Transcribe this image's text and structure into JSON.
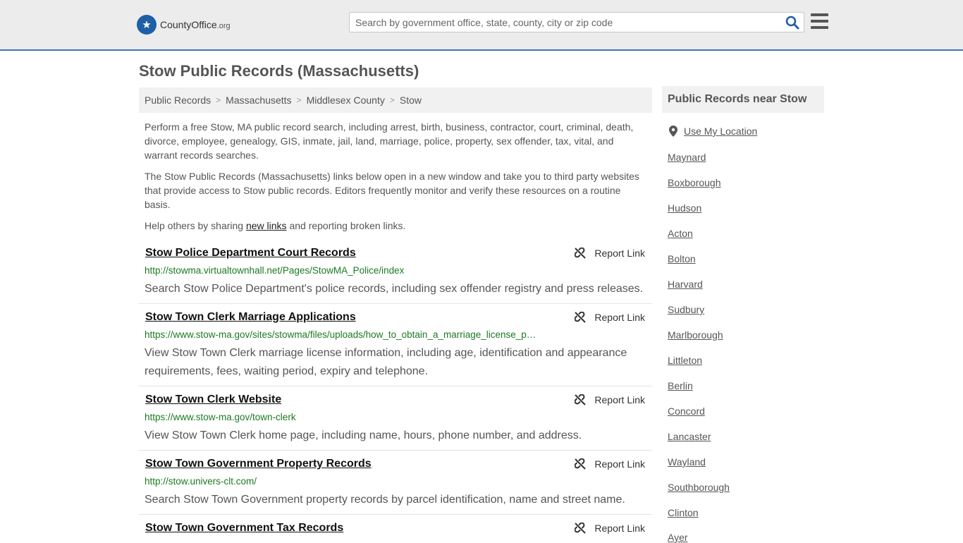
{
  "header": {
    "logo_main": "CountyOffice",
    "logo_tld": ".org",
    "search_placeholder": "Search by government office, state, county, city or zip code",
    "search_icon": "search-icon",
    "menu_icon": "hamburger-menu-icon",
    "accent": "#3f75b3"
  },
  "page": {
    "title": "Stow Public Records (Massachusetts)"
  },
  "breadcrumb": [
    "Public Records",
    "Massachusetts",
    "Middlesex County",
    "Stow"
  ],
  "intro": {
    "p1": "Perform a free Stow, MA public record search, including arrest, birth, business, contractor, court, criminal, death, divorce, employee, genealogy, GIS, inmate, jail, land, marriage, police, property, sex offender, tax, vital, and warrant records searches.",
    "p2": "The Stow Public Records (Massachusetts) links below open in a new window and take you to third party websites that provide access to Stow public records. Editors frequently monitor and verify these resources on a routine basis.",
    "p3_before": "Help others by sharing ",
    "p3_link": "new links",
    "p3_after": " and reporting broken links."
  },
  "report_label": "Report Link",
  "records": [
    {
      "title": "Stow Police Department Court Records",
      "url": "http://stowma.virtualtownhall.net/Pages/StowMA_Police/index",
      "desc": "Search Stow Police Department's police records, including sex offender registry and press releases."
    },
    {
      "title": "Stow Town Clerk Marriage Applications",
      "url": "https://www.stow-ma.gov/sites/stowma/files/uploads/how_to_obtain_a_marriage_license_p…",
      "desc": "View Stow Town Clerk marriage license information, including age, identification and appearance requirements, fees, waiting period, expiry and telephone."
    },
    {
      "title": "Stow Town Clerk Website",
      "url": "https://www.stow-ma.gov/town-clerk",
      "desc": "View Stow Town Clerk home page, including name, hours, phone number, and address."
    },
    {
      "title": "Stow Town Government Property Records",
      "url": "http://stow.univers-clt.com/",
      "desc": "Search Stow Town Government property records by parcel identification, name and street name."
    },
    {
      "title": "Stow Town Government Tax Records",
      "url": "",
      "desc": ""
    }
  ],
  "sidebar": {
    "title": "Public Records near Stow",
    "use_location": "Use My Location",
    "places": [
      "Maynard",
      "Boxborough",
      "Hudson",
      "Acton",
      "Bolton",
      "Harvard",
      "Sudbury",
      "Marlborough",
      "Littleton",
      "Berlin",
      "Concord",
      "Lancaster",
      "Wayland",
      "Southborough",
      "Clinton",
      "Ayer"
    ]
  }
}
